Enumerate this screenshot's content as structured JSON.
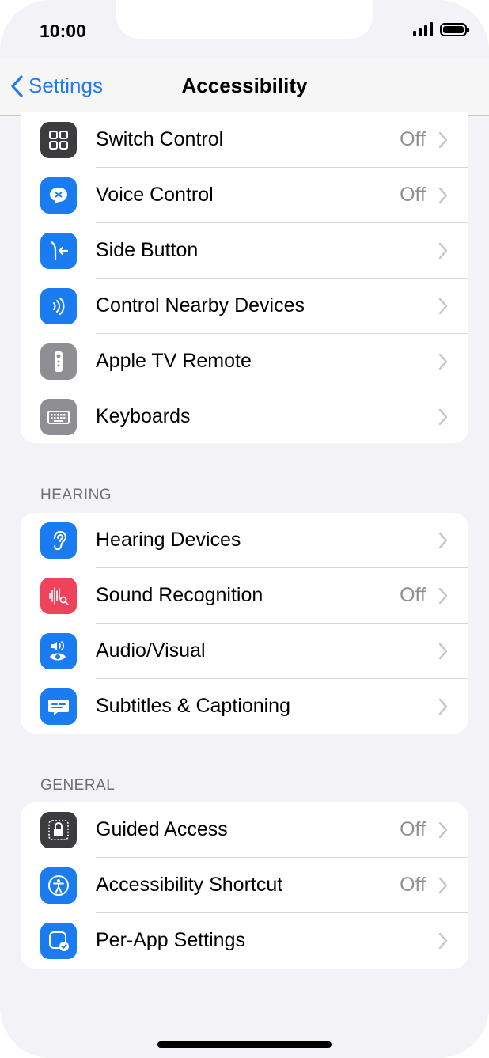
{
  "status_bar": {
    "time": "10:00"
  },
  "nav": {
    "back_label": "Settings",
    "title": "Accessibility"
  },
  "colors": {
    "accent": "#1f7bf2",
    "icon_dark": "#3c3c3e",
    "icon_blue": "#1a7cf0",
    "icon_gray": "#8e8e93",
    "icon_red": "#f0435b"
  },
  "group1": {
    "rows": [
      {
        "label": "Switch Control",
        "value": "Off",
        "icon": "switch-control-icon"
      },
      {
        "label": "Voice Control",
        "value": "Off",
        "icon": "voice-control-icon"
      },
      {
        "label": "Side Button",
        "value": "",
        "icon": "side-button-icon"
      },
      {
        "label": "Control Nearby Devices",
        "value": "",
        "icon": "nearby-devices-icon"
      },
      {
        "label": "Apple TV Remote",
        "value": "",
        "icon": "tv-remote-icon"
      },
      {
        "label": "Keyboards",
        "value": "",
        "icon": "keyboard-icon"
      }
    ]
  },
  "hearing": {
    "header": "HEARING",
    "rows": [
      {
        "label": "Hearing Devices",
        "value": "",
        "icon": "ear-icon"
      },
      {
        "label": "Sound Recognition",
        "value": "Off",
        "icon": "sound-recognition-icon"
      },
      {
        "label": "Audio/Visual",
        "value": "",
        "icon": "audio-visual-icon"
      },
      {
        "label": "Subtitles & Captioning",
        "value": "",
        "icon": "subtitles-icon"
      }
    ]
  },
  "general": {
    "header": "GENERAL",
    "rows": [
      {
        "label": "Guided Access",
        "value": "Off",
        "icon": "lock-icon"
      },
      {
        "label": "Accessibility Shortcut",
        "value": "Off",
        "icon": "accessibility-icon"
      },
      {
        "label": "Per-App Settings",
        "value": "",
        "icon": "per-app-icon"
      }
    ]
  }
}
